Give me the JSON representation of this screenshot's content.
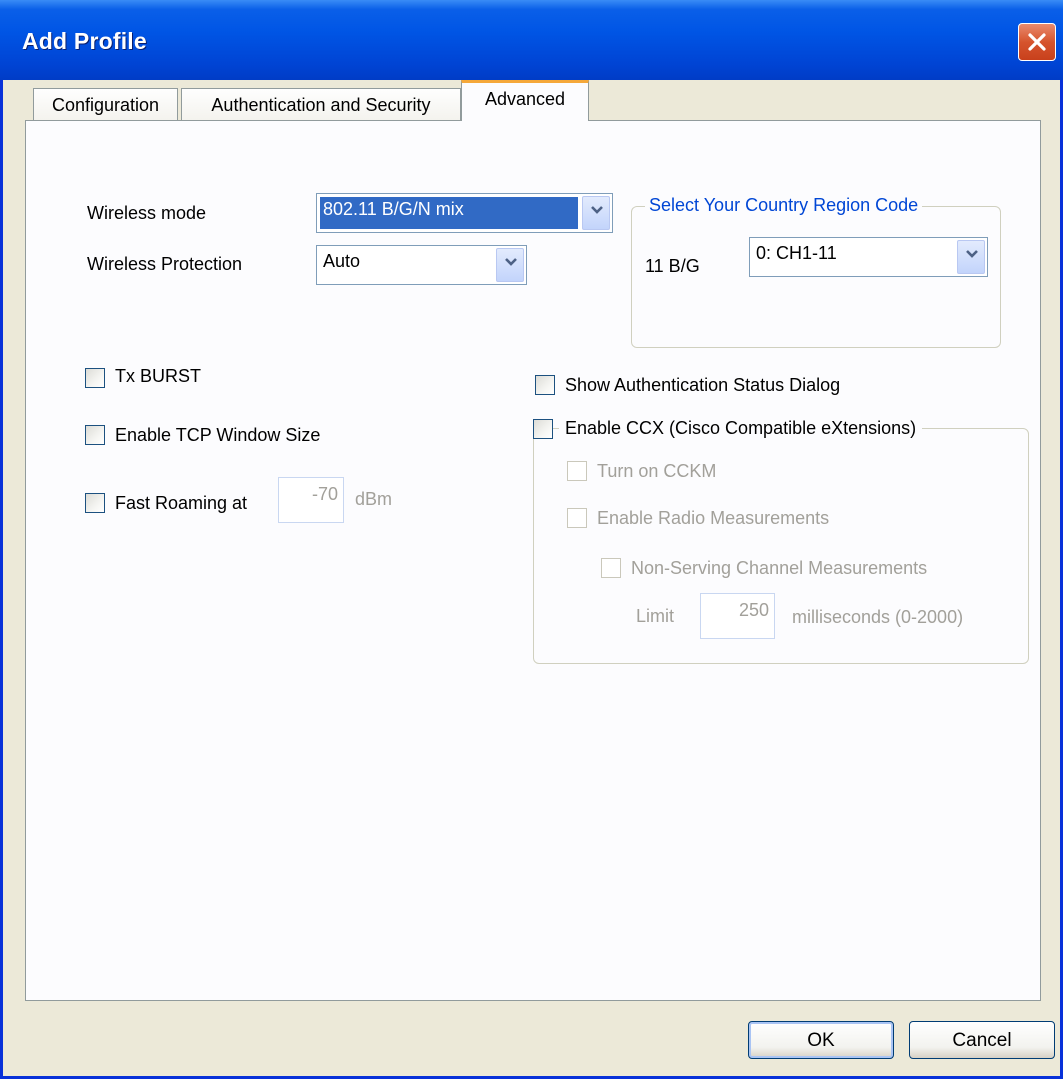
{
  "window": {
    "title": "Add Profile"
  },
  "tabs": [
    {
      "label": "Configuration",
      "active": false
    },
    {
      "label": "Authentication and Security",
      "active": false
    },
    {
      "label": "Advanced",
      "active": true
    }
  ],
  "wireless_mode": {
    "label": "Wireless mode",
    "value": "802.11 B/G/N mix"
  },
  "wireless_protection": {
    "label": "Wireless Protection",
    "value": "Auto"
  },
  "country_region": {
    "title": "Select Your Country Region Code",
    "band_label": "11 B/G",
    "value": "0: CH1-11"
  },
  "tx_burst": {
    "label": "Tx BURST",
    "checked": false
  },
  "tcp_window": {
    "label": "Enable TCP Window Size",
    "checked": false
  },
  "fast_roaming": {
    "label": "Fast Roaming at",
    "value": "-70",
    "unit": "dBm",
    "checked": false
  },
  "show_auth_status": {
    "label": "Show Authentication Status Dialog",
    "checked": false
  },
  "ccx": {
    "label": "Enable CCX (Cisco Compatible eXtensions)",
    "checked": false,
    "cckm_label": "Turn on CCKM",
    "radio_measurements_label": "Enable Radio Measurements",
    "non_serving_label": "Non-Serving Channel Measurements",
    "limit_label": "Limit",
    "limit_value": "250",
    "limit_unit": "milliseconds (0-2000)"
  },
  "buttons": {
    "ok": "OK",
    "cancel": "Cancel"
  },
  "colors": {
    "titlebar": "#0055e5",
    "active_tab_accent": "#f5a83a",
    "group_title": "#0046d5",
    "selection": "#316ac5"
  }
}
